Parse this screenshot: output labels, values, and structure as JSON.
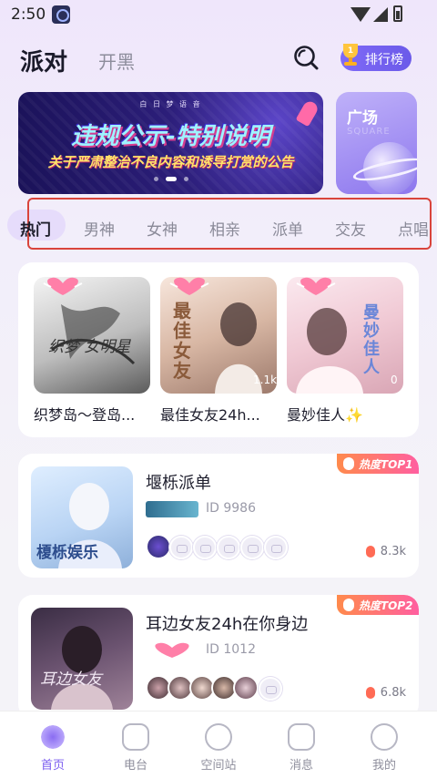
{
  "status_bar": {
    "time": "2:50"
  },
  "header": {
    "tabs": [
      {
        "label": "派对",
        "active": true
      },
      {
        "label": "开黑",
        "active": false
      }
    ],
    "rank_button": "排行榜",
    "icons": [
      "search-icon",
      "trophy-icon"
    ]
  },
  "banner": {
    "tagline": "白 日 梦 语 音",
    "title": "违规公示-特别说明",
    "subtitle": "关于严肃整治不良内容和诱导打赏的公告",
    "page_count": 3,
    "active_page": 2
  },
  "square_card": {
    "title": "广场",
    "watermark": "SQUARE"
  },
  "categories": [
    "热门",
    "男神",
    "女神",
    "相亲",
    "派单",
    "交友",
    "点唱"
  ],
  "active_category": "热门",
  "grid_rooms": [
    {
      "name": "织梦岛～登岛...",
      "heat": "",
      "cover_text": "织梦 女明星"
    },
    {
      "name": "最佳女友24h...",
      "heat": "1.1k",
      "cover_text": "最佳女友"
    },
    {
      "name": "曼妙佳人✨",
      "heat": "0",
      "cover_text": "曼妙佳人"
    }
  ],
  "list_rooms": [
    {
      "badge": "热度TOP1",
      "title": "堰栎派单",
      "id": "ID 9986",
      "heat": "8.3k",
      "cover_text": "榎栎娱乐"
    },
    {
      "badge": "热度TOP2",
      "title": "耳边女友24h在你身边",
      "id": "ID 1012",
      "heat": "6.8k",
      "cover_text": "耳边女友"
    }
  ],
  "bottom_nav": [
    {
      "label": "首页",
      "icon": "home-wave-icon",
      "active": true
    },
    {
      "label": "电台",
      "icon": "radio-icon",
      "active": false
    },
    {
      "label": "空间站",
      "icon": "compass-icon",
      "active": false
    },
    {
      "label": "消息",
      "icon": "message-icon",
      "active": false
    },
    {
      "label": "我的",
      "icon": "profile-icon",
      "active": false
    }
  ],
  "colors": {
    "accent": "#7a5cf0",
    "highlight_border": "#d9443b",
    "badge_gradient_start": "#ff8a4c",
    "badge_gradient_end": "#ff5fa0"
  }
}
